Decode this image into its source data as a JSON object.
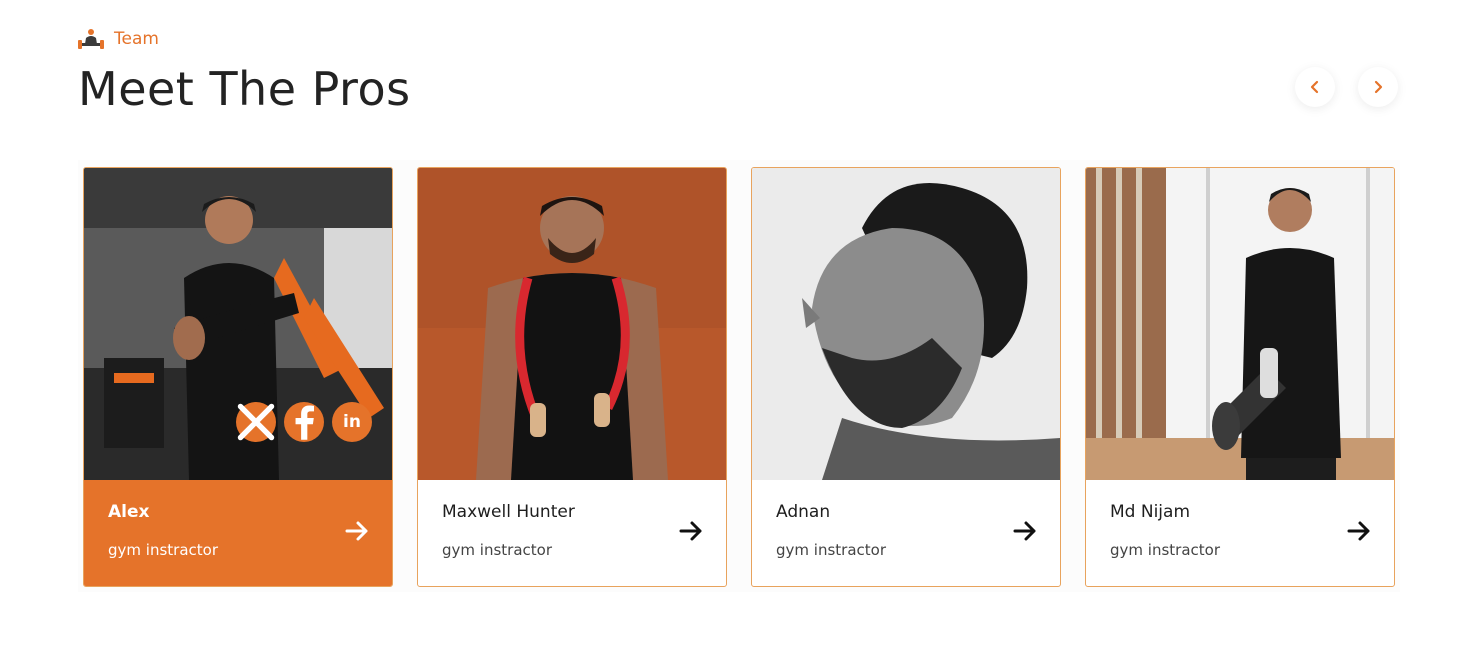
{
  "section": {
    "tagline": "Team",
    "title": "Meet The Pros",
    "accent_color": "#e5732a"
  },
  "nav": {
    "prev_icon": "chevron-left-icon",
    "next_icon": "chevron-right-icon"
  },
  "team": [
    {
      "name": "Alex",
      "role": "gym instractor",
      "active": true,
      "socials": [
        {
          "icon": "x-twitter-icon"
        },
        {
          "icon": "facebook-icon"
        },
        {
          "icon": "linkedin-icon",
          "text": "in"
        }
      ]
    },
    {
      "name": "Maxwell Hunter",
      "role": "gym instractor",
      "active": false
    },
    {
      "name": "Adnan",
      "role": "gym instractor",
      "active": false
    },
    {
      "name": "Md Nijam",
      "role": "gym instractor",
      "active": false
    }
  ]
}
